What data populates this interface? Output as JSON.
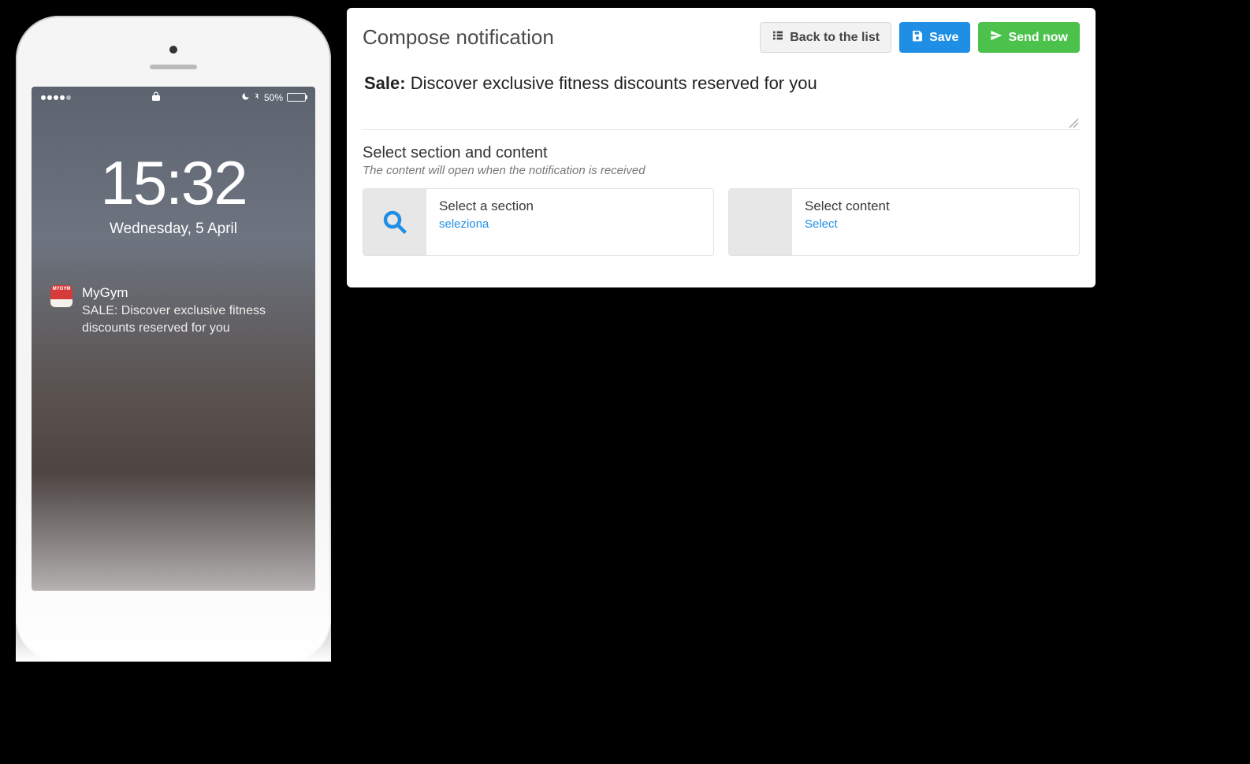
{
  "phone": {
    "status": {
      "battery_text": "50%",
      "signal_dots_on": 4
    },
    "lock": {
      "time": "15:32",
      "date": "Wednesday, 5 April"
    },
    "notification": {
      "app_badge": "MYGYM",
      "app_name": "MyGym",
      "message": "SALE: Discover exclusive fitness discounts reserved for you"
    }
  },
  "panel": {
    "title": "Compose notification",
    "buttons": {
      "back": "Back to the list",
      "save": "Save",
      "send": "Send now"
    },
    "compose": {
      "bold_prefix": "Sale:",
      "text": "Discover exclusive fitness discounts reserved for you"
    },
    "section": {
      "title": "Select section and content",
      "subtitle": "The content will open when the notification is received"
    },
    "selectors": {
      "section": {
        "label": "Select a section",
        "link": "seleziona"
      },
      "content": {
        "label": "Select content",
        "link": "Select"
      }
    }
  }
}
